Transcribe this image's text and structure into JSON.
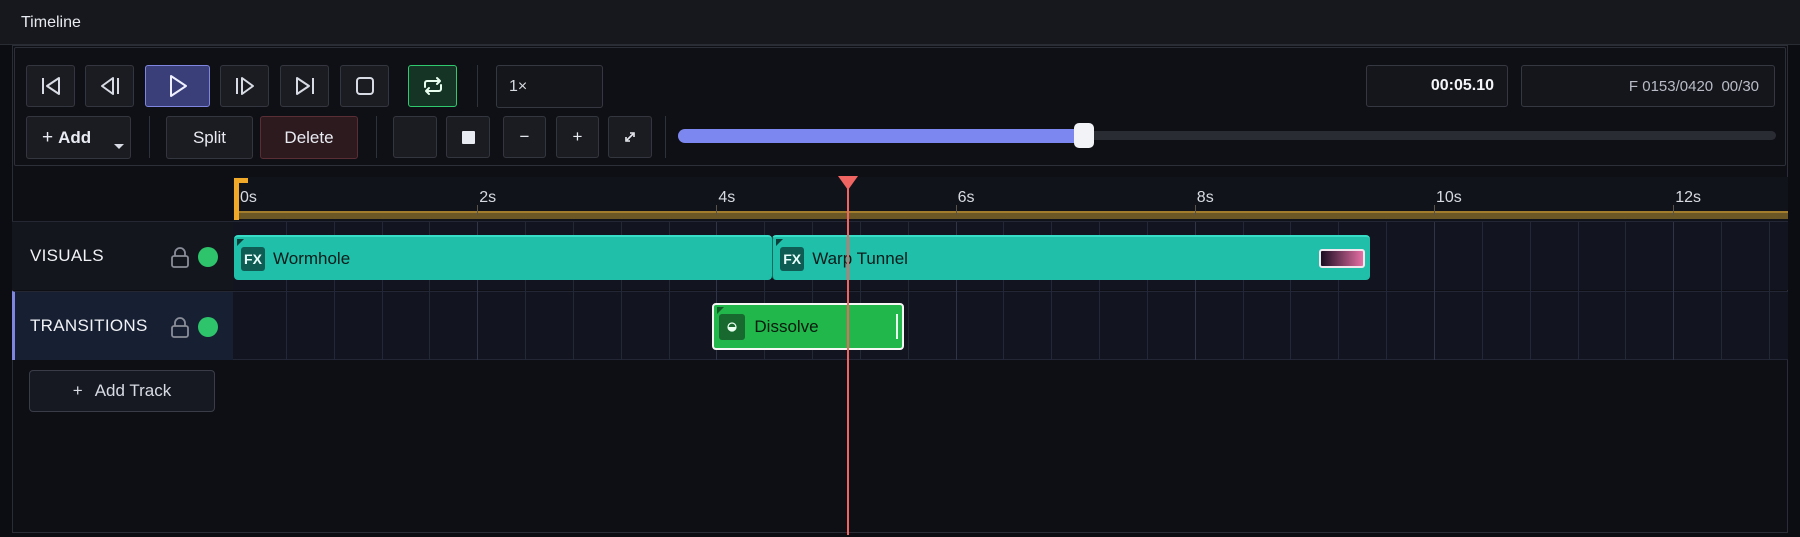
{
  "window": {
    "title": "Timeline"
  },
  "transport": {
    "speed": "1×",
    "timecode": "00:05.10",
    "frame_info": "F 0153/0420  00/30"
  },
  "edit": {
    "add_label": "Add",
    "add_prefix": "+",
    "split_label": "Split",
    "delete_label": "Delete",
    "zoom_out": "−",
    "zoom_in": "+"
  },
  "zoom": {
    "level": 0.37
  },
  "ruler": {
    "ticks": [
      "0s",
      "2s",
      "4s",
      "6s",
      "8s",
      "10s",
      "12s"
    ]
  },
  "playhead": {
    "time_seconds": 5.1
  },
  "tracks": [
    {
      "name": "VISUALS",
      "clips": [
        {
          "label": "Wormhole",
          "badge": "FX",
          "start_s": 0,
          "end_s": 4.5
        },
        {
          "label": "Warp Tunnel",
          "badge": "FX",
          "start_s": 4.5,
          "end_s": 9.5
        }
      ]
    },
    {
      "name": "TRANSITIONS",
      "clips": [
        {
          "label": "Dissolve",
          "start_s": 4.0,
          "end_s": 5.6
        }
      ]
    }
  ],
  "add_track": {
    "prefix": "+",
    "label": "Add Track"
  },
  "colors": {
    "accent": "#7d87f0",
    "fx_clip": "#1fbfa9",
    "transition_clip": "#22b74b",
    "playhead": "#f06462",
    "track_enabled": "#2ec46c",
    "ruler_band": "#a37d2e"
  }
}
